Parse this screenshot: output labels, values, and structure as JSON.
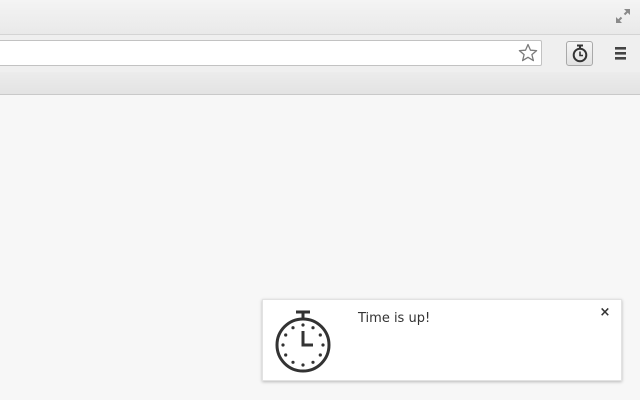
{
  "browser": {
    "titlebar": {
      "fullscreen_icon": "fullscreen-arrows-icon"
    },
    "toolbar": {
      "omnibox": {
        "value": "",
        "placeholder": ""
      },
      "bookmark_icon": "star-icon",
      "extension_icon": "stopwatch-icon",
      "menu_icon": "hamburger-menu-icon"
    }
  },
  "notification": {
    "icon": "stopwatch-icon",
    "message": "Time is up!",
    "close_label": "×"
  }
}
